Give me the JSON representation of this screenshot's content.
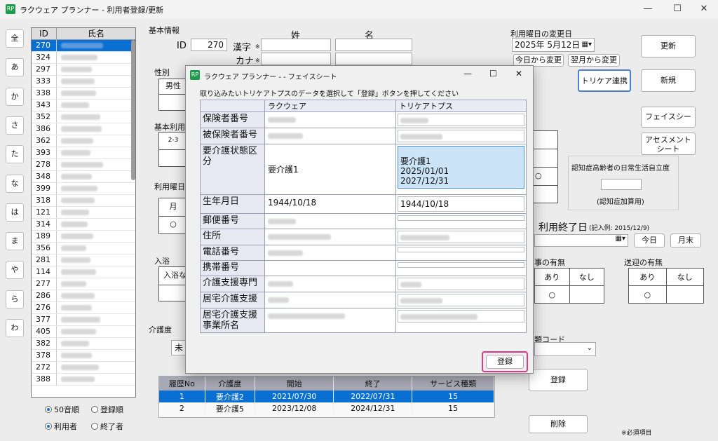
{
  "window": {
    "title": "ラクウェア プランナー - 利用者登録/更新",
    "minimize": "—",
    "maximize": "☐",
    "close": "✕"
  },
  "kana_buttons": [
    "全",
    "あ",
    "か",
    "さ",
    "た",
    "な",
    "は",
    "ま",
    "や",
    "ら",
    "わ"
  ],
  "user_list": {
    "headers": {
      "id": "ID",
      "name": "氏名"
    },
    "ids": [
      "270",
      "324",
      "297",
      "333",
      "338",
      "343",
      "352",
      "386",
      "362",
      "393",
      "278",
      "348",
      "399",
      "318",
      "121",
      "314",
      "189",
      "356",
      "281",
      "114",
      "277",
      "286",
      "276",
      "377",
      "405",
      "382",
      "378",
      "272",
      "388"
    ]
  },
  "sort_options": {
    "kana": "50音順",
    "reg": "登録順",
    "user": "利用者",
    "ended": "終了者"
  },
  "basic_info": {
    "section": "基本情報",
    "id_label": "ID",
    "id_value": "270",
    "sei": "姓",
    "mei": "名",
    "kanji": "漢字",
    "kana": "カナ",
    "req": "※",
    "gender_label": "性別",
    "gender_male": "男性",
    "basic_use": "基本利用時",
    "basic_use_value": "2-3",
    "days_label": "利用曜日",
    "day_mon": "月",
    "day_mark": "○",
    "bath_label": "入浴",
    "bath_cell": "入浴な"
  },
  "right_panel": {
    "change_day_label": "利用曜日の変更日",
    "date": "2025年 5月12日",
    "today_change": "今日から変更",
    "next_month_change": "翌月から変更",
    "update": "更新",
    "new": "新規",
    "tricare": "トリケア連携",
    "face_sheet": "フェイスシート",
    "assessment": "アセスメント\nシート",
    "dementia_label": "認知症高齢者の日常生活自立度",
    "dementia_note": "(認知症加算用)",
    "end_date_label": "利用終了日",
    "end_date_example": "(記入例: 2015/12/9)",
    "today": "今日",
    "month_end": "月末",
    "meal_label": "事の有無",
    "pick_label": "送迎の有無",
    "ari": "あり",
    "nashi": "なし",
    "mark": "○",
    "code_label": "類コード",
    "register": "登録",
    "delete": "削除",
    "required_note": "※必須項目"
  },
  "care_level": {
    "label": "介護度",
    "select_value": "未",
    "history_headers": [
      "履歴No",
      "介護度",
      "開始",
      "終了",
      "サービス種類"
    ],
    "history_rows": [
      [
        "1",
        "要介護2",
        "2021/07/30",
        "2022/07/31",
        "15"
      ],
      [
        "2",
        "要介護5",
        "2023/12/08",
        "2024/12/31",
        "15"
      ]
    ]
  },
  "modal": {
    "title": "ラクウェア プランナー - - フェイスシート",
    "instruction": "取り込みたいトリケアトプスのデータを選択して「登録」ボタンを押してください",
    "col_rakuware": "ラクウェア",
    "col_tricare": "トリケアトプス",
    "rows": [
      {
        "label": "保険者番号",
        "left": "",
        "right": ""
      },
      {
        "label": "被保険者番号",
        "left": "",
        "right": ""
      },
      {
        "label": "要介護状態区分",
        "left": "要介護1",
        "right": "要介護1\n2025/01/01\n2027/12/31"
      },
      {
        "label": "生年月日",
        "left": "1944/10/18",
        "right": "1944/10/18"
      },
      {
        "label": "郵便番号",
        "left": "",
        "right": ""
      },
      {
        "label": "住所",
        "left": "",
        "right": ""
      },
      {
        "label": "電話番号",
        "left": "",
        "right": ""
      },
      {
        "label": "携帯番号",
        "left": "",
        "right": ""
      },
      {
        "label": "介護支援専門",
        "left": "",
        "right": ""
      },
      {
        "label": "居宅介護支援",
        "left": "",
        "right": ""
      },
      {
        "label": "居宅介護支援事業所名",
        "left": "",
        "right": ""
      }
    ],
    "register": "登録"
  }
}
